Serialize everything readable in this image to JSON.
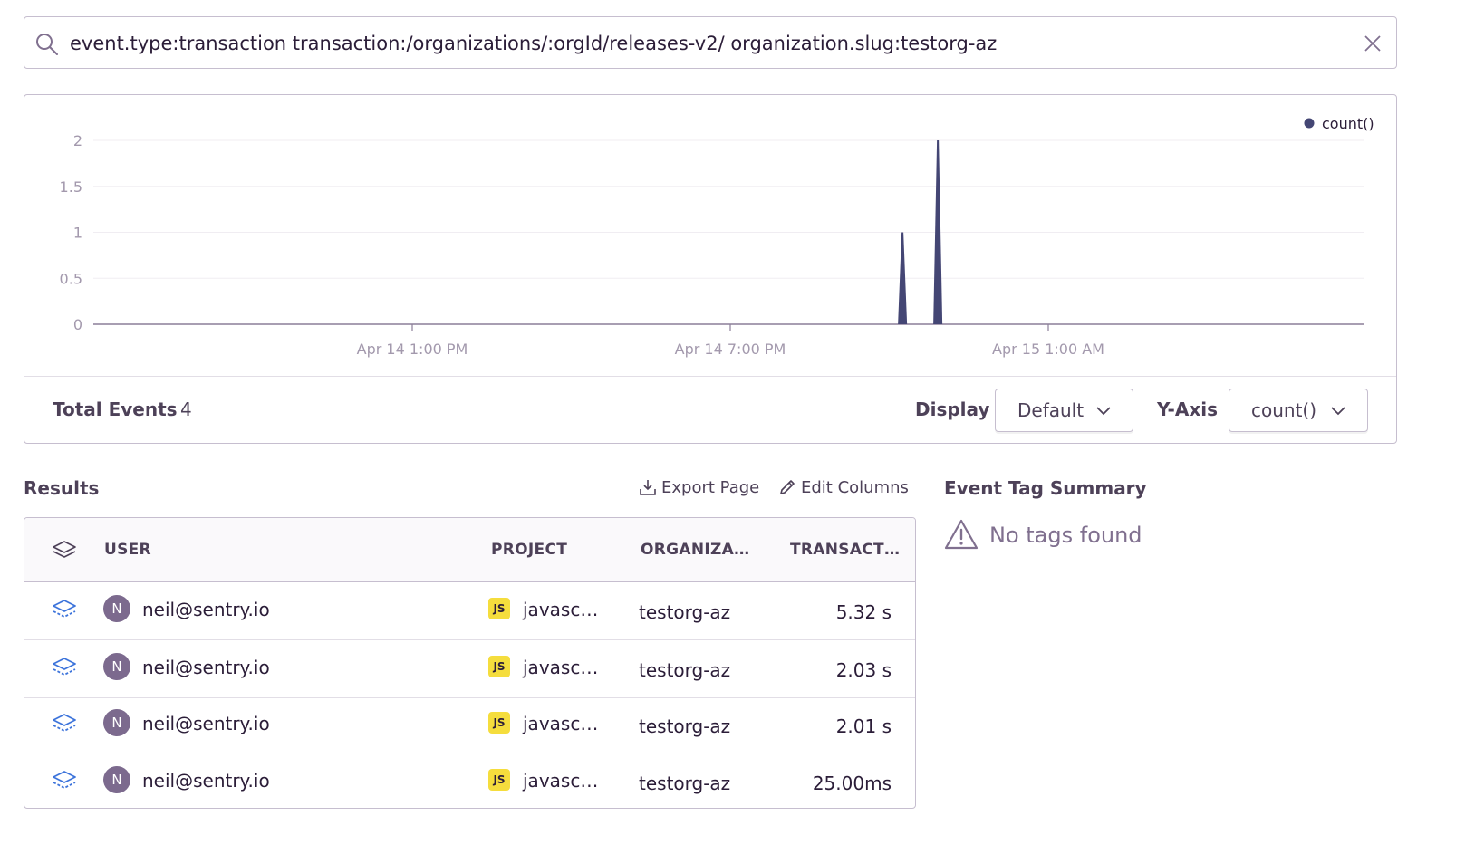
{
  "search": {
    "query": "event.type:transaction transaction:/organizations/:orgId/releases-v2/ organization.slug:testorg-az"
  },
  "chart_data": {
    "type": "area",
    "legend": [
      "count()"
    ],
    "legend_position": "top-right",
    "y_ticks": [
      "2",
      "1.5",
      "1",
      "0.5",
      "0"
    ],
    "ylim": [
      0,
      2
    ],
    "x_ticks": [
      "Apr 14 1:00 PM",
      "Apr 14 7:00 PM",
      "Apr 15 1:00 AM"
    ],
    "series": [
      {
        "name": "count()",
        "color": "#444674",
        "points": [
          {
            "x": "Apr 14 10:15 PM",
            "y": 1
          },
          {
            "x": "Apr 14 10:55 PM",
            "y": 2
          }
        ]
      }
    ]
  },
  "footer": {
    "total_label": "Total Events",
    "total_value": "4",
    "display_label": "Display",
    "display_value": "Default",
    "yaxis_label": "Y-Axis",
    "yaxis_value": "count()"
  },
  "results": {
    "title": "Results",
    "export_label": "Export Page",
    "edit_label": "Edit Columns",
    "columns": [
      "USER",
      "PROJECT",
      "ORGANIZA…",
      "TRANSACT…"
    ],
    "rows": [
      {
        "avatar": "N",
        "user": "neil@sentry.io",
        "project": "javasc…",
        "org": "testorg-az",
        "duration": "5.32 s"
      },
      {
        "avatar": "N",
        "user": "neil@sentry.io",
        "project": "javasc…",
        "org": "testorg-az",
        "duration": "2.03 s"
      },
      {
        "avatar": "N",
        "user": "neil@sentry.io",
        "project": "javasc…",
        "org": "testorg-az",
        "duration": "2.01 s"
      },
      {
        "avatar": "N",
        "user": "neil@sentry.io",
        "project": "javasc…",
        "org": "testorg-az",
        "duration": "25.00ms"
      }
    ],
    "project_badge": "JS"
  },
  "tag_summary": {
    "title": "Event Tag Summary",
    "empty_text": "No tags found"
  },
  "colors": {
    "accent": "#444674",
    "link_icon": "#3d74db",
    "text": "#2b1d38",
    "muted": "#80708f",
    "js_badge": "#f5dd3d"
  }
}
